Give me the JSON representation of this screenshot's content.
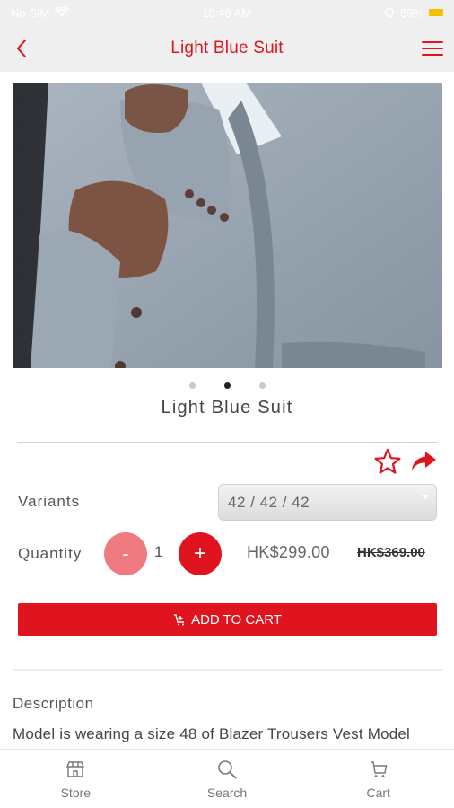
{
  "status_bar": {
    "carrier": "No SIM",
    "time": "10:48 AM",
    "battery": "69%"
  },
  "nav": {
    "title": "Light Blue Suit"
  },
  "product": {
    "image_desc": "suit",
    "carousel_total": 3,
    "carousel_active": 2,
    "title": "Light Blue Suit",
    "variants_label": "Variants",
    "variant_selected": "42 / 42 / 42",
    "quantity_label": "Quantity",
    "minus_label": "-",
    "plus_label": "+",
    "quantity": "1",
    "price": "HK$299.00",
    "original_price": "HK$369.00",
    "add_to_cart": "ADD TO CART",
    "description_heading": "Description",
    "description": "Model is wearing a size 48 of Blazer Trousers Vest Model"
  },
  "tabs": [
    {
      "label": "Store",
      "icon": "store-icon"
    },
    {
      "label": "Search",
      "icon": "search-icon"
    },
    {
      "label": "Cart",
      "icon": "cart-icon"
    }
  ],
  "colors": {
    "accent": "#e0141e",
    "accent_light": "#ef7a7f"
  }
}
